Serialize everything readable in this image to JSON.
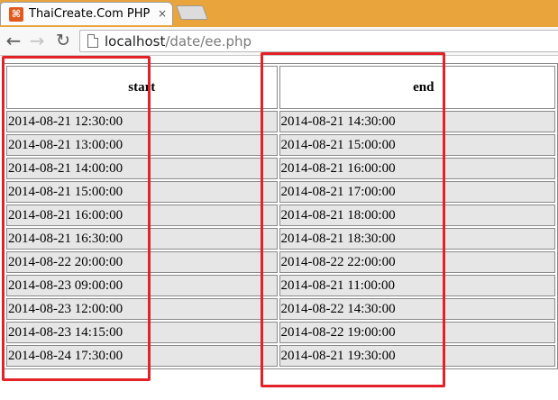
{
  "browser": {
    "tab": {
      "favicon": "thaicreate-favicon",
      "title": "ThaiCreate.Com PHP & M",
      "close_glyph": "×"
    },
    "toolbar": {
      "back_glyph": "←",
      "forward_glyph": "→",
      "reload_glyph": "↻",
      "url_host": "localhost",
      "url_path": "/date/ee.php"
    }
  },
  "table": {
    "headers": {
      "start": "start",
      "end": "end"
    },
    "rows": [
      {
        "start": "2014-08-21 12:30:00",
        "end": "2014-08-21 14:30:00"
      },
      {
        "start": "2014-08-21 13:00:00",
        "end": "2014-08-21 15:00:00"
      },
      {
        "start": "2014-08-21 14:00:00",
        "end": "2014-08-21 16:00:00"
      },
      {
        "start": "2014-08-21 15:00:00",
        "end": "2014-08-21 17:00:00"
      },
      {
        "start": "2014-08-21 16:00:00",
        "end": "2014-08-21 18:00:00"
      },
      {
        "start": "2014-08-21 16:30:00",
        "end": "2014-08-21 18:30:00"
      },
      {
        "start": "2014-08-22 20:00:00",
        "end": "2014-08-22 22:00:00"
      },
      {
        "start": "2014-08-23 09:00:00",
        "end": "2014-08-21 11:00:00"
      },
      {
        "start": "2014-08-23 12:00:00",
        "end": "2014-08-22 14:30:00"
      },
      {
        "start": "2014-08-23 14:15:00",
        "end": "2014-08-22 19:00:00"
      },
      {
        "start": "2014-08-24 17:30:00",
        "end": "2014-08-21 19:30:00"
      }
    ]
  },
  "colors": {
    "tabstrip": "#e9a43c",
    "annotation": "#e32227",
    "cell_background": "#e6e6e6"
  }
}
